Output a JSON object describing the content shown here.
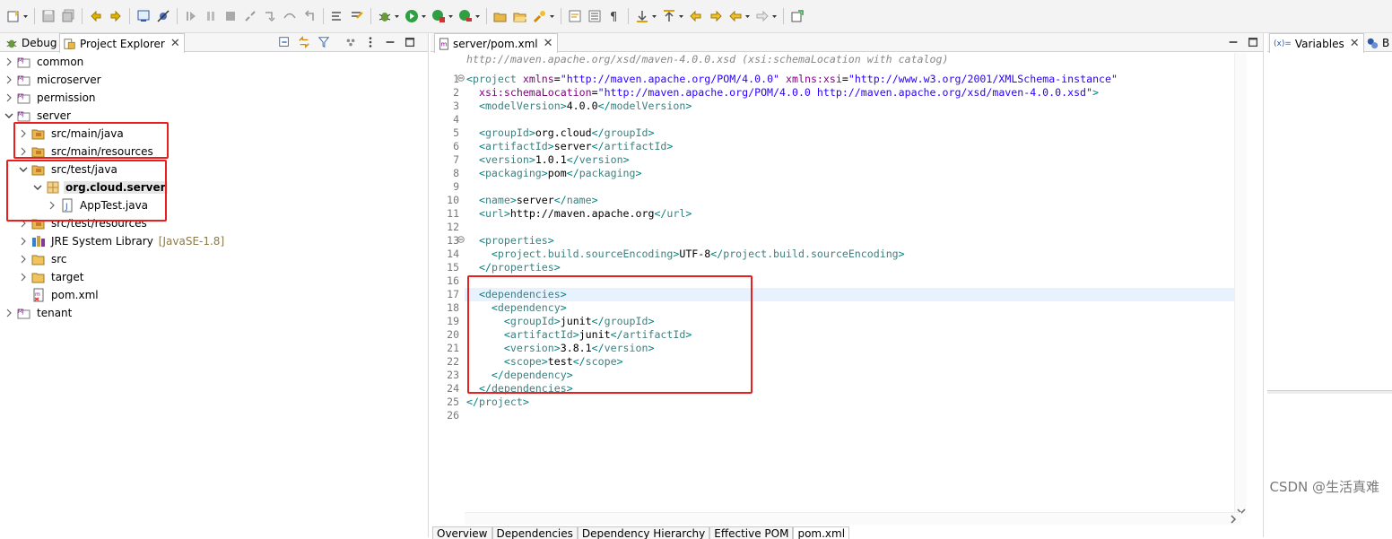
{
  "left_view": {
    "tabs": [
      {
        "label": "Debug",
        "icon": "debug-icon"
      },
      {
        "label": "Project Explorer",
        "icon": "project-explorer-icon",
        "active": true
      }
    ],
    "tree": [
      {
        "label": "common",
        "icon": "maven-project-icon",
        "level": 0,
        "expanded": false
      },
      {
        "label": "microserver",
        "icon": "maven-project-icon",
        "level": 0,
        "expanded": false
      },
      {
        "label": "permission",
        "icon": "maven-project-icon",
        "level": 0,
        "expanded": false
      },
      {
        "label": "server",
        "icon": "maven-project-icon",
        "level": 0,
        "expanded": true
      },
      {
        "label": "src/main/java",
        "icon": "source-folder-icon",
        "level": 1,
        "expanded": false
      },
      {
        "label": "src/main/resources",
        "icon": "source-folder-icon",
        "level": 1,
        "expanded": false
      },
      {
        "label": "src/test/java",
        "icon": "source-folder-icon",
        "level": 1,
        "expanded": true
      },
      {
        "label": "org.cloud.server",
        "icon": "package-icon",
        "level": 2,
        "expanded": true,
        "selected": true
      },
      {
        "label": "AppTest.java",
        "icon": "java-file-icon",
        "level": 3,
        "expanded": false
      },
      {
        "label": "src/test/resources",
        "icon": "source-folder-icon",
        "level": 1,
        "expanded": false
      },
      {
        "label": "JRE System Library",
        "decor": "[JavaSE-1.8]",
        "icon": "library-icon",
        "level": 1,
        "expanded": false
      },
      {
        "label": "src",
        "icon": "folder-icon",
        "level": 1,
        "expanded": false
      },
      {
        "label": "target",
        "icon": "folder-icon",
        "level": 1,
        "expanded": false
      },
      {
        "label": "pom.xml",
        "icon": "pom-file-icon",
        "level": 1,
        "leaf": true
      },
      {
        "label": "tenant",
        "icon": "maven-project-icon",
        "level": 0,
        "expanded": false
      }
    ]
  },
  "editor": {
    "tab_label": "server/pom.xml",
    "hint": "http://maven.apache.org/xsd/maven-4.0.0.xsd (xsi:schemaLocation with catalog)",
    "lines": [
      {
        "n": "1",
        "fold": true,
        "text": "<project xmlns=\"http://maven.apache.org/POM/4.0.0\" xmlns:xsi=\"http://www.w3.org/2001/XMLSchema-instance\""
      },
      {
        "n": "2",
        "text": "  xsi:schemaLocation=\"http://maven.apache.org/POM/4.0.0 http://maven.apache.org/xsd/maven-4.0.0.xsd\">"
      },
      {
        "n": "3",
        "text": "  <modelVersion>4.0.0</modelVersion>"
      },
      {
        "n": "4",
        "text": ""
      },
      {
        "n": "5",
        "text": "  <groupId>org.cloud</groupId>"
      },
      {
        "n": "6",
        "text": "  <artifactId>server</artifactId>"
      },
      {
        "n": "7",
        "text": "  <version>1.0.1</version>"
      },
      {
        "n": "8",
        "text": "  <packaging>pom</packaging>"
      },
      {
        "n": "9",
        "text": ""
      },
      {
        "n": "10",
        "text": "  <name>server</name>"
      },
      {
        "n": "11",
        "text": "  <url>http://maven.apache.org</url>"
      },
      {
        "n": "12",
        "text": ""
      },
      {
        "n": "13",
        "fold": true,
        "text": "  <properties>"
      },
      {
        "n": "14",
        "text": "    <project.build.sourceEncoding>UTF-8</project.build.sourceEncoding>"
      },
      {
        "n": "15",
        "text": "  </properties>"
      },
      {
        "n": "16",
        "text": ""
      },
      {
        "n": "17",
        "text": "  <dependencies>",
        "current": true
      },
      {
        "n": "18",
        "text": "    <dependency>"
      },
      {
        "n": "19",
        "text": "      <groupId>junit</groupId>"
      },
      {
        "n": "20",
        "text": "      <artifactId>junit</artifactId>"
      },
      {
        "n": "21",
        "text": "      <version>3.8.1</version>"
      },
      {
        "n": "22",
        "text": "      <scope>test</scope>"
      },
      {
        "n": "23",
        "text": "    </dependency>"
      },
      {
        "n": "24",
        "text": "  </dependencies>"
      },
      {
        "n": "25",
        "text": "</project>"
      },
      {
        "n": "26",
        "text": ""
      }
    ],
    "bottom_tabs": [
      "Overview",
      "Dependencies",
      "Dependency Hierarchy",
      "Effective POM",
      "pom.xml"
    ]
  },
  "right_view": {
    "tabs": [
      {
        "label": "Variables",
        "prefix": "(x)="
      },
      {
        "label": "B"
      }
    ]
  },
  "watermark": "CSDN @生活真难",
  "colors": {
    "highlight_box": "#e81f1f",
    "xml_tag": "#3f7f7f",
    "xml_attr": "#7f007f",
    "xml_value": "#2a00ff"
  }
}
